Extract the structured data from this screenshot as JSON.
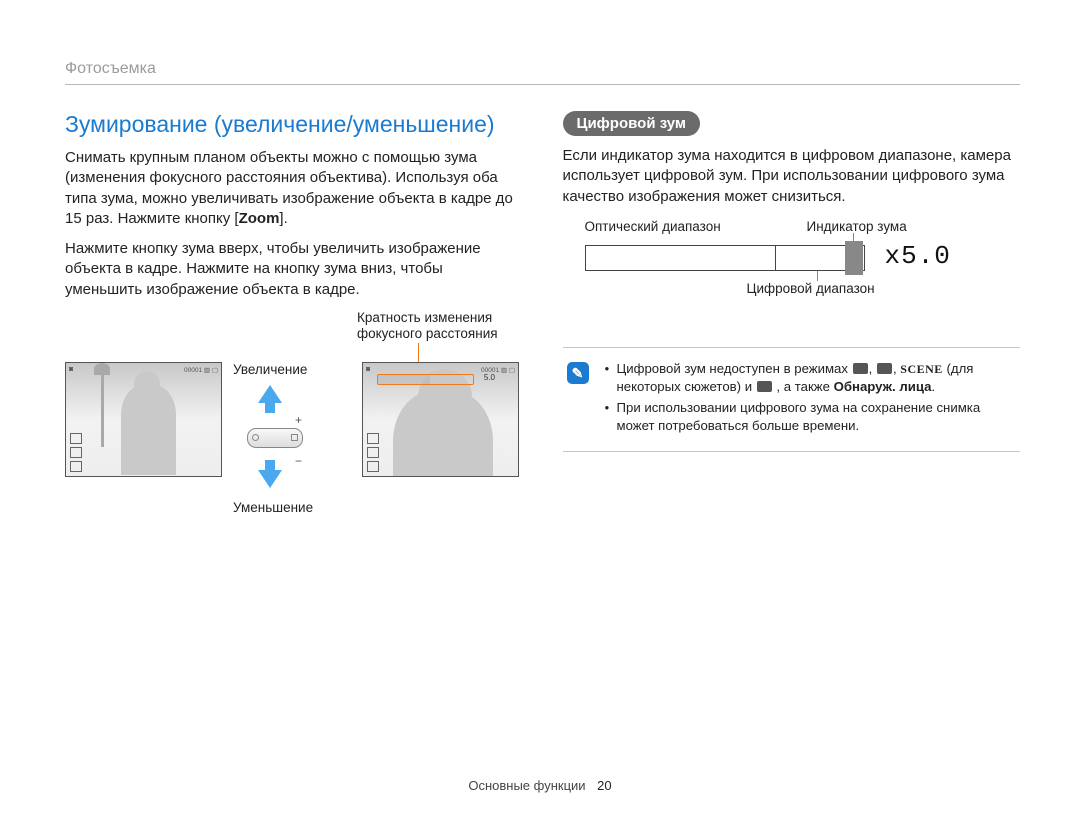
{
  "breadcrumb": "Фотосъемка",
  "left": {
    "heading": "Зумирование (увеличение/уменьшение)",
    "para1_a": "Снимать крупным планом объекты можно с помощью зума (изменения фокусного расстояния объектива). Используя оба типа зума, можно увеличивать изображение объекта в кадре до 15 раз. Нажмите кнопку [",
    "para1_zoom": "Zoom",
    "para1_b": "].",
    "para2": "Нажмите кнопку зума вверх, чтобы увеличить изображение объекта в кадре. Нажмите на кнопку зума вниз, чтобы уменьшить изображение объекта в кадре.",
    "label_krat_1": "Кратность изменения",
    "label_krat_2": "фокусного расстояния",
    "label_up": "Увеличение",
    "label_down": "Уменьшение"
  },
  "right": {
    "pill": "Цифровой зум",
    "para": "Если индикатор зума находится в цифровом диапазоне, камера использует цифровой зум. При использовании цифрового зума качество изображения может снизиться.",
    "label_optical": "Оптический диапазон",
    "label_indicator": "Индикатор зума",
    "label_digital": "Цифровой диапазон",
    "zoom_value": "x5.0",
    "note1_a": "Цифровой зум недоступен в режимах ",
    "note1_mid": " (для некоторых сюжетов) и ",
    "note1_end": ", а также ",
    "note1_bold": "Обнаруж. лица",
    "note1_period": ".",
    "scene_label": "SCENE",
    "note2": "При использовании цифрового зума на сохранение снимка может потребоваться больше времени."
  },
  "footer_section": "Основные функции",
  "footer_page": "20"
}
